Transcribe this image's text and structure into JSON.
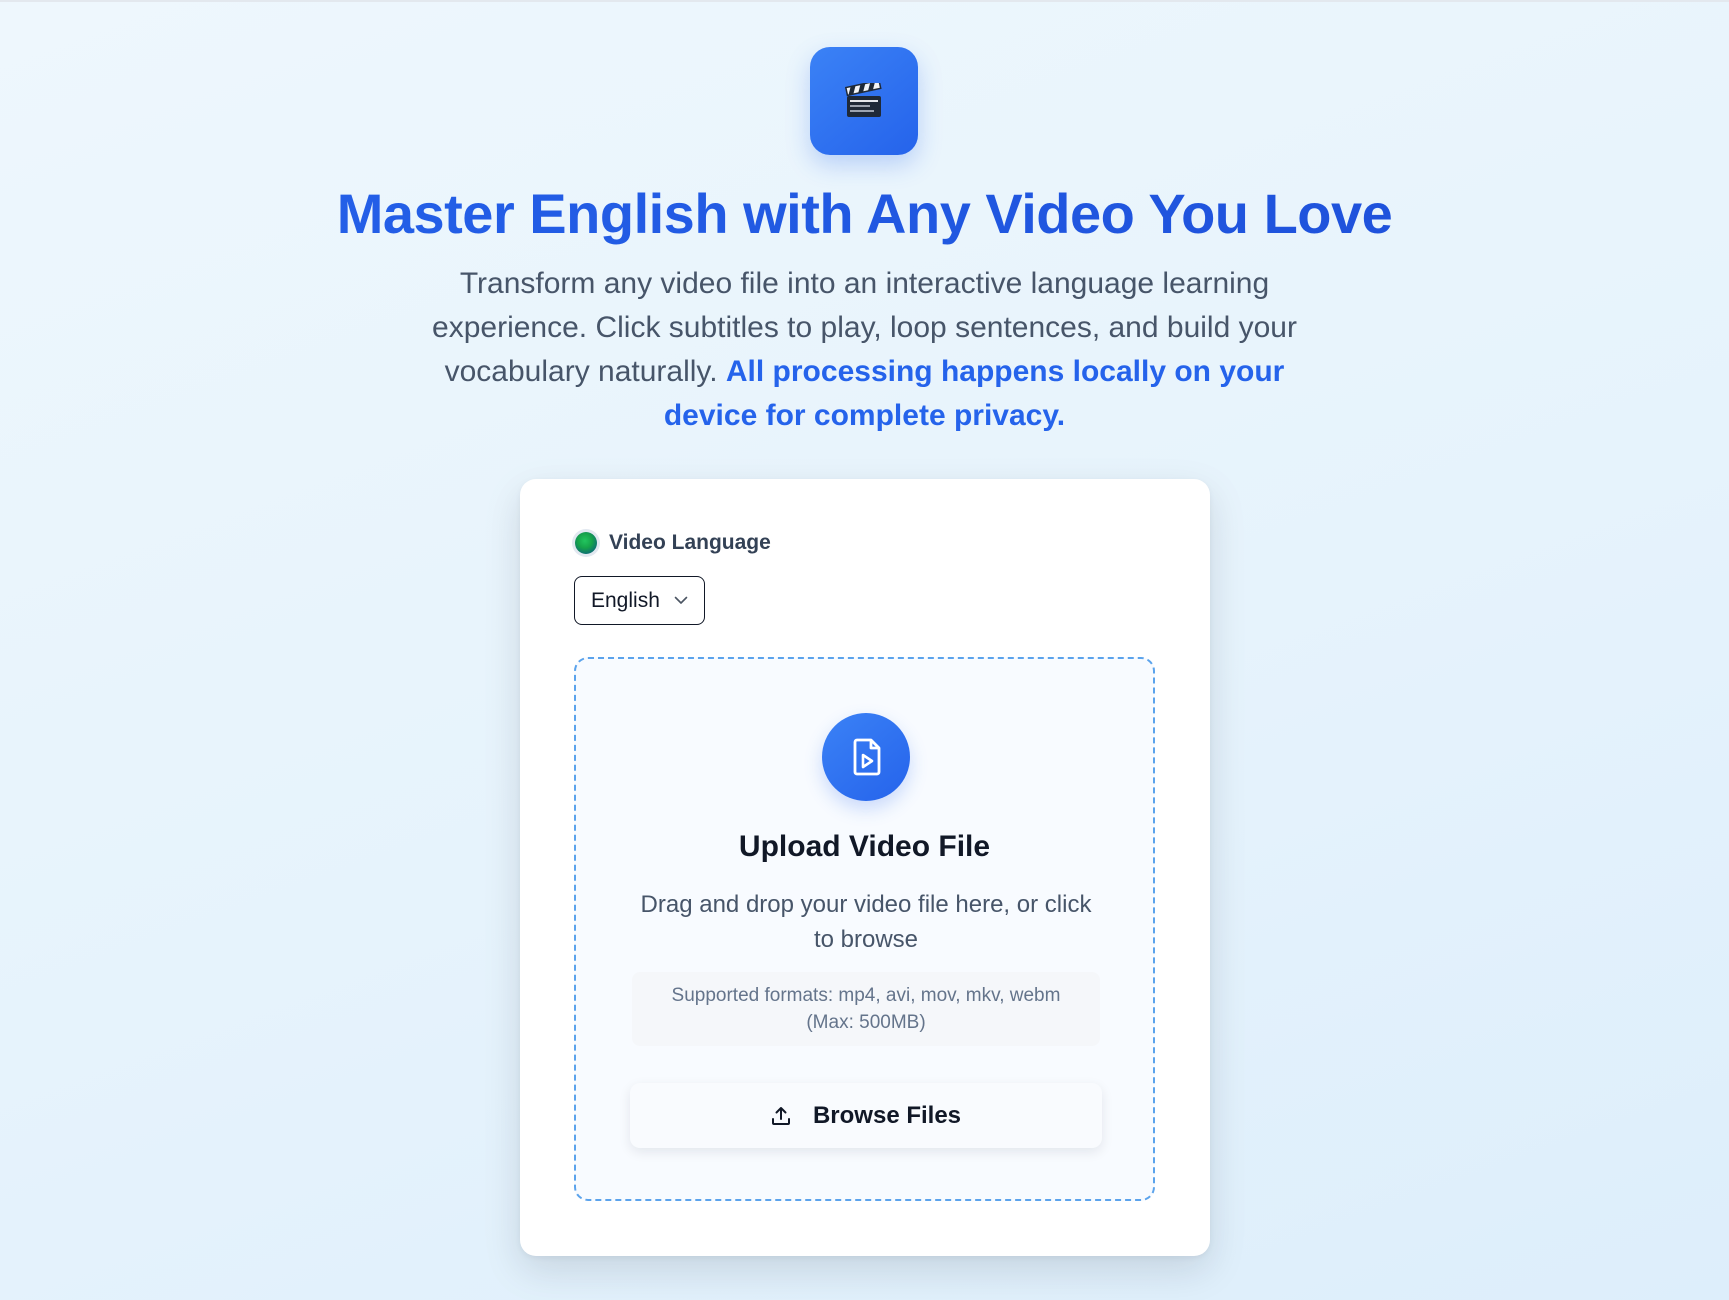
{
  "header": {
    "logo_icon": "clapperboard-icon",
    "title": "Master English with Any Video You Love",
    "subtitle_plain": "Transform any video file into an interactive language learning experience. Click subtitles to play, loop sentences, and build your vocabulary naturally.",
    "subtitle_highlight": "All processing happens locally on your device for complete privacy."
  },
  "language": {
    "icon": "globe-icon",
    "label": "Video Language",
    "selected": "English"
  },
  "upload": {
    "icon": "file-video-icon",
    "title": "Upload Video File",
    "description": "Drag and drop your video file here, or click to browse",
    "formats": "Supported formats: mp4, avi, mov, mkv, webm (Max: 500MB)",
    "browse_icon": "upload-icon",
    "browse_label": "Browse Files"
  },
  "colors": {
    "accent": "#2563eb",
    "dropzone_border": "#5ba3ec"
  }
}
